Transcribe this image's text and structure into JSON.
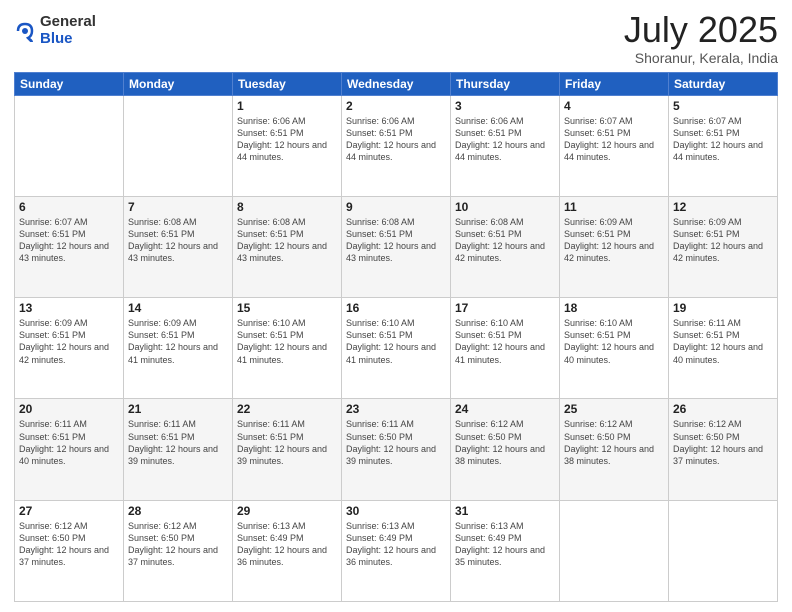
{
  "logo": {
    "general": "General",
    "blue": "Blue"
  },
  "title": "July 2025",
  "location": "Shoranur, Kerala, India",
  "days_of_week": [
    "Sunday",
    "Monday",
    "Tuesday",
    "Wednesday",
    "Thursday",
    "Friday",
    "Saturday"
  ],
  "weeks": [
    [
      {
        "day": "",
        "info": ""
      },
      {
        "day": "",
        "info": ""
      },
      {
        "day": "1",
        "info": "Sunrise: 6:06 AM\nSunset: 6:51 PM\nDaylight: 12 hours and 44 minutes."
      },
      {
        "day": "2",
        "info": "Sunrise: 6:06 AM\nSunset: 6:51 PM\nDaylight: 12 hours and 44 minutes."
      },
      {
        "day": "3",
        "info": "Sunrise: 6:06 AM\nSunset: 6:51 PM\nDaylight: 12 hours and 44 minutes."
      },
      {
        "day": "4",
        "info": "Sunrise: 6:07 AM\nSunset: 6:51 PM\nDaylight: 12 hours and 44 minutes."
      },
      {
        "day": "5",
        "info": "Sunrise: 6:07 AM\nSunset: 6:51 PM\nDaylight: 12 hours and 44 minutes."
      }
    ],
    [
      {
        "day": "6",
        "info": "Sunrise: 6:07 AM\nSunset: 6:51 PM\nDaylight: 12 hours and 43 minutes."
      },
      {
        "day": "7",
        "info": "Sunrise: 6:08 AM\nSunset: 6:51 PM\nDaylight: 12 hours and 43 minutes."
      },
      {
        "day": "8",
        "info": "Sunrise: 6:08 AM\nSunset: 6:51 PM\nDaylight: 12 hours and 43 minutes."
      },
      {
        "day": "9",
        "info": "Sunrise: 6:08 AM\nSunset: 6:51 PM\nDaylight: 12 hours and 43 minutes."
      },
      {
        "day": "10",
        "info": "Sunrise: 6:08 AM\nSunset: 6:51 PM\nDaylight: 12 hours and 42 minutes."
      },
      {
        "day": "11",
        "info": "Sunrise: 6:09 AM\nSunset: 6:51 PM\nDaylight: 12 hours and 42 minutes."
      },
      {
        "day": "12",
        "info": "Sunrise: 6:09 AM\nSunset: 6:51 PM\nDaylight: 12 hours and 42 minutes."
      }
    ],
    [
      {
        "day": "13",
        "info": "Sunrise: 6:09 AM\nSunset: 6:51 PM\nDaylight: 12 hours and 42 minutes."
      },
      {
        "day": "14",
        "info": "Sunrise: 6:09 AM\nSunset: 6:51 PM\nDaylight: 12 hours and 41 minutes."
      },
      {
        "day": "15",
        "info": "Sunrise: 6:10 AM\nSunset: 6:51 PM\nDaylight: 12 hours and 41 minutes."
      },
      {
        "day": "16",
        "info": "Sunrise: 6:10 AM\nSunset: 6:51 PM\nDaylight: 12 hours and 41 minutes."
      },
      {
        "day": "17",
        "info": "Sunrise: 6:10 AM\nSunset: 6:51 PM\nDaylight: 12 hours and 41 minutes."
      },
      {
        "day": "18",
        "info": "Sunrise: 6:10 AM\nSunset: 6:51 PM\nDaylight: 12 hours and 40 minutes."
      },
      {
        "day": "19",
        "info": "Sunrise: 6:11 AM\nSunset: 6:51 PM\nDaylight: 12 hours and 40 minutes."
      }
    ],
    [
      {
        "day": "20",
        "info": "Sunrise: 6:11 AM\nSunset: 6:51 PM\nDaylight: 12 hours and 40 minutes."
      },
      {
        "day": "21",
        "info": "Sunrise: 6:11 AM\nSunset: 6:51 PM\nDaylight: 12 hours and 39 minutes."
      },
      {
        "day": "22",
        "info": "Sunrise: 6:11 AM\nSunset: 6:51 PM\nDaylight: 12 hours and 39 minutes."
      },
      {
        "day": "23",
        "info": "Sunrise: 6:11 AM\nSunset: 6:50 PM\nDaylight: 12 hours and 39 minutes."
      },
      {
        "day": "24",
        "info": "Sunrise: 6:12 AM\nSunset: 6:50 PM\nDaylight: 12 hours and 38 minutes."
      },
      {
        "day": "25",
        "info": "Sunrise: 6:12 AM\nSunset: 6:50 PM\nDaylight: 12 hours and 38 minutes."
      },
      {
        "day": "26",
        "info": "Sunrise: 6:12 AM\nSunset: 6:50 PM\nDaylight: 12 hours and 37 minutes."
      }
    ],
    [
      {
        "day": "27",
        "info": "Sunrise: 6:12 AM\nSunset: 6:50 PM\nDaylight: 12 hours and 37 minutes."
      },
      {
        "day": "28",
        "info": "Sunrise: 6:12 AM\nSunset: 6:50 PM\nDaylight: 12 hours and 37 minutes."
      },
      {
        "day": "29",
        "info": "Sunrise: 6:13 AM\nSunset: 6:49 PM\nDaylight: 12 hours and 36 minutes."
      },
      {
        "day": "30",
        "info": "Sunrise: 6:13 AM\nSunset: 6:49 PM\nDaylight: 12 hours and 36 minutes."
      },
      {
        "day": "31",
        "info": "Sunrise: 6:13 AM\nSunset: 6:49 PM\nDaylight: 12 hours and 35 minutes."
      },
      {
        "day": "",
        "info": ""
      },
      {
        "day": "",
        "info": ""
      }
    ]
  ]
}
